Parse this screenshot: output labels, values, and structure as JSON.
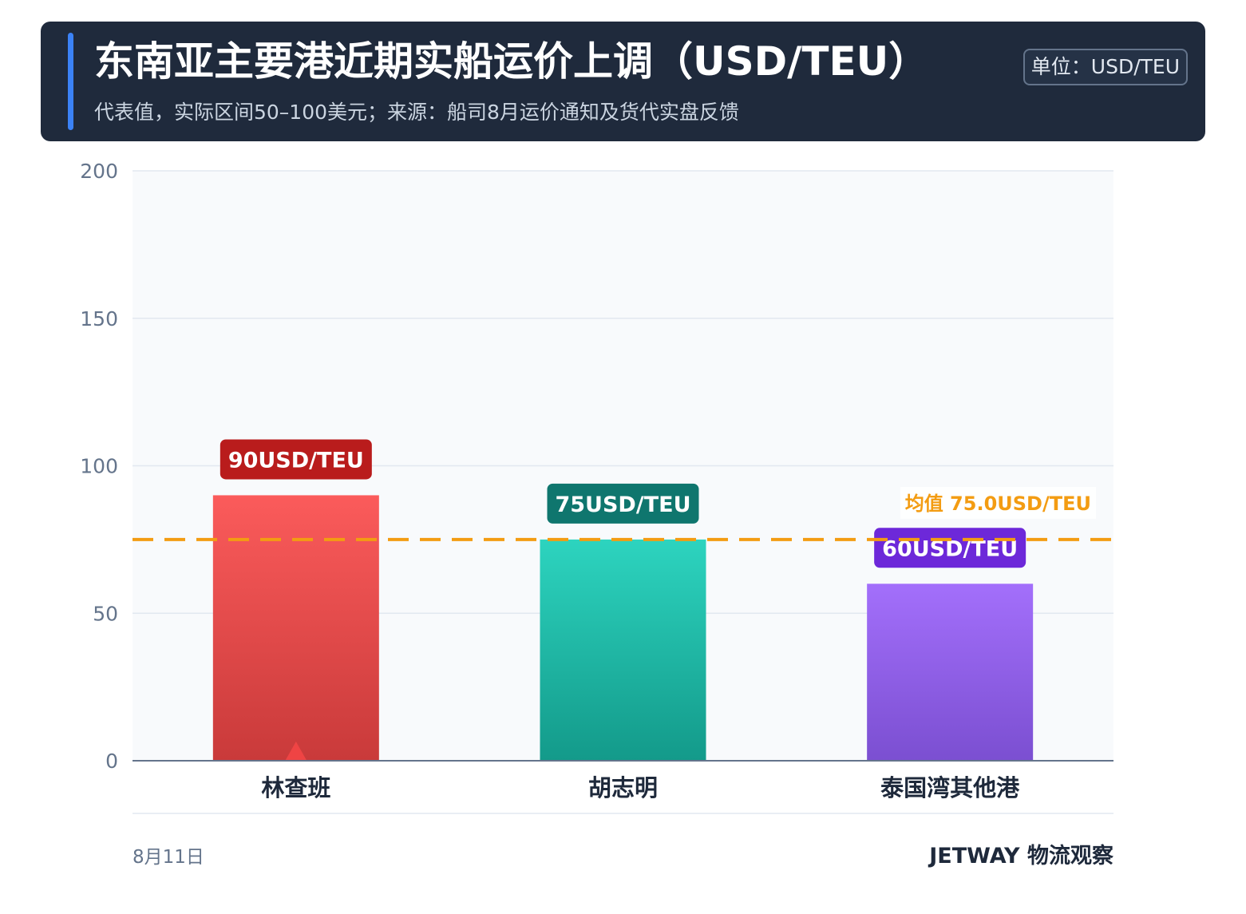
{
  "header": {
    "title": "东南亚主要港近期实船运价上调（USD/TEU）",
    "subtitle": "代表值，实际区间50–100美元；来源：船司8月运价通知及货代实盘反馈",
    "unit_badge": "单位：USD/TEU"
  },
  "footer": {
    "date": "8月11日",
    "brand": "JETWAY 物流观察"
  },
  "chart_data": {
    "type": "bar",
    "title": "东南亚主要港近期实船运价上调（USD/TEU）",
    "categories": [
      "林查班",
      "胡志明",
      "泰国湾其他港"
    ],
    "values": [
      90,
      75,
      60
    ],
    "value_labels": [
      "90USD/TEU",
      "75USD/TEU",
      "60USD/TEU"
    ],
    "ylim": [
      0,
      200
    ],
    "yticks": [
      0,
      50,
      100,
      150,
      200
    ],
    "grid": true,
    "average": {
      "value": 75.0,
      "label": "均值 75.0USD/TEU",
      "color": "#f39c12"
    },
    "highlight_category": "林查班",
    "bar_colors": [
      {
        "top": "#fb5b5b",
        "bottom": "#c93a3a",
        "label_bg": "#b91c1c"
      },
      {
        "top": "#2dd4bf",
        "bottom": "#139a8a",
        "label_bg": "#0f766e"
      },
      {
        "top": "#a36ffb",
        "bottom": "#7b4fd1",
        "label_bg": "#6d28d9"
      }
    ],
    "marker_color": "#ef4444"
  }
}
